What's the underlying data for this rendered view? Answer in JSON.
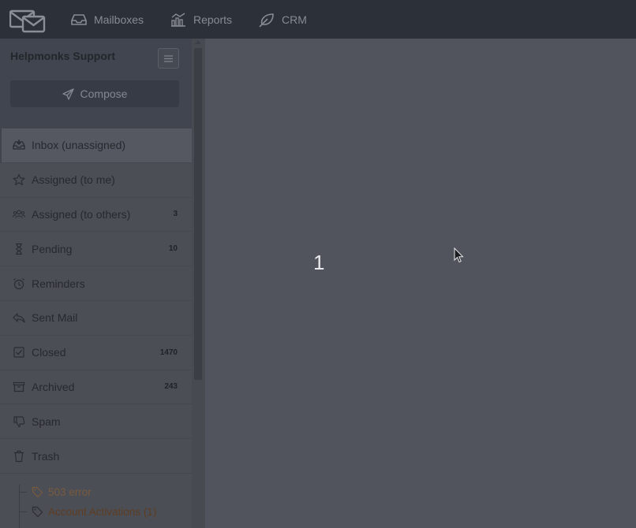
{
  "nav": {
    "items": [
      {
        "label": "Mailboxes",
        "icon": "inbox-icon"
      },
      {
        "label": "Reports",
        "icon": "chart-icon"
      },
      {
        "label": "CRM",
        "icon": "leaf-icon"
      }
    ]
  },
  "sidebar": {
    "mailbox_name": "Helpmonks Support",
    "compose_label": "Compose",
    "folders": [
      {
        "label": "Inbox (unassigned)",
        "icon": "inbox-tray-icon",
        "count": ""
      },
      {
        "label": "Assigned (to me)",
        "icon": "star-icon",
        "count": ""
      },
      {
        "label": "Assigned (to others)",
        "icon": "users-icon",
        "count": "3"
      },
      {
        "label": "Pending",
        "icon": "hourglass-icon",
        "count": "10"
      },
      {
        "label": "Reminders",
        "icon": "alarm-clock-icon",
        "count": ""
      },
      {
        "label": "Sent Mail",
        "icon": "reply-icon",
        "count": ""
      },
      {
        "label": "Closed",
        "icon": "check-square-icon",
        "count": "1470"
      },
      {
        "label": "Archived",
        "icon": "archive-icon",
        "count": "243"
      },
      {
        "label": "Spam",
        "icon": "thumbs-down-icon",
        "count": ""
      },
      {
        "label": "Trash",
        "icon": "trash-icon",
        "count": ""
      }
    ],
    "tags": [
      {
        "label": "503 error",
        "color": "#7a5a3e"
      },
      {
        "label": "Account Activations (1)",
        "color": "#5e3d22"
      }
    ]
  },
  "overlay": {
    "number": "1"
  },
  "colors": {
    "topbar": "#2c3039",
    "sidebar": "#4b4e55",
    "main": "#51545c"
  }
}
